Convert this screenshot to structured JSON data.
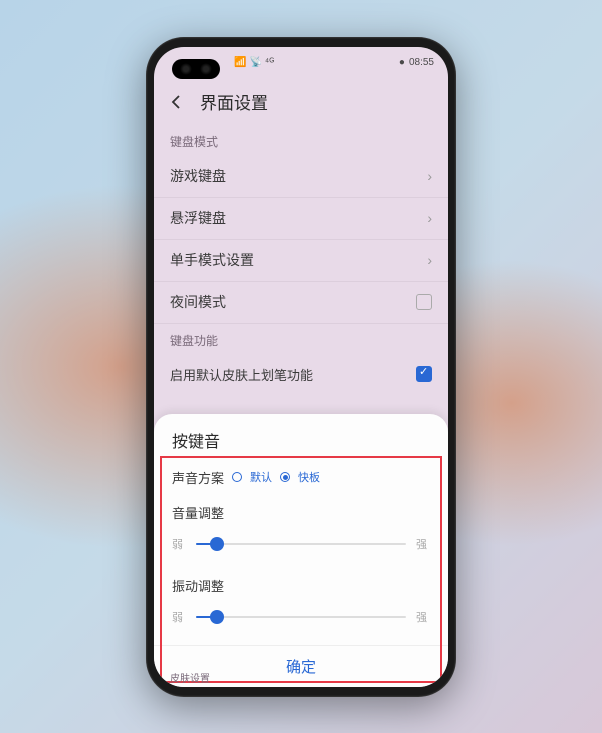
{
  "status_bar": {
    "signal_text": "⁴ᴳ",
    "time": "08:55",
    "battery_text": "●"
  },
  "header": {
    "title": "界面设置"
  },
  "sections": {
    "keyboard_mode": {
      "header": "键盘模式",
      "items": [
        {
          "label": "游戏键盘"
        },
        {
          "label": "悬浮键盘"
        },
        {
          "label": "单手模式设置"
        },
        {
          "label": "夜间模式"
        }
      ]
    },
    "keyboard_function": {
      "header": "键盘功能",
      "partial_item": "启用默认皮肤上划笔功能"
    }
  },
  "dialog": {
    "title": "按键音",
    "sound_scheme": {
      "label": "声音方案",
      "options": [
        {
          "label": "默认",
          "selected": false
        },
        {
          "label": "快板",
          "selected": true
        }
      ]
    },
    "volume": {
      "title": "音量调整",
      "min_label": "弱",
      "max_label": "强",
      "value_percent": 10
    },
    "vibration": {
      "title": "振动调整",
      "min_label": "弱",
      "max_label": "强",
      "value_percent": 10
    },
    "confirm": "确定"
  },
  "bottom_hint": "皮肤设置"
}
